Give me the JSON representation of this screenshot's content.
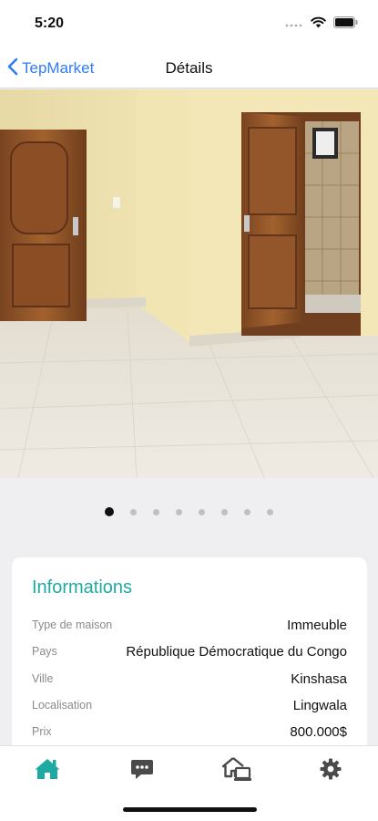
{
  "status_bar": {
    "time": "5:20"
  },
  "nav": {
    "back_label": "TepMarket",
    "title": "Détails"
  },
  "carousel": {
    "page_count": 8,
    "current_index": 0
  },
  "info": {
    "title": "Informations",
    "rows": [
      {
        "label": "Type de maison",
        "value": "Immeuble"
      },
      {
        "label": "Pays",
        "value": "République Démocratique du Congo"
      },
      {
        "label": "Ville",
        "value": "Kinshasa"
      },
      {
        "label": "Localisation",
        "value": "Lingwala"
      },
      {
        "label": "Prix",
        "value": "800.000$"
      }
    ]
  },
  "tab_bar": {
    "items": [
      {
        "icon": "home-icon",
        "active": true
      },
      {
        "icon": "chat-icon",
        "active": false
      },
      {
        "icon": "my-properties-icon",
        "active": false
      },
      {
        "icon": "gear-icon",
        "active": false
      }
    ]
  },
  "colors": {
    "accent": "#1fa9a3",
    "link": "#2f7cf6",
    "background": "#efeff1"
  }
}
